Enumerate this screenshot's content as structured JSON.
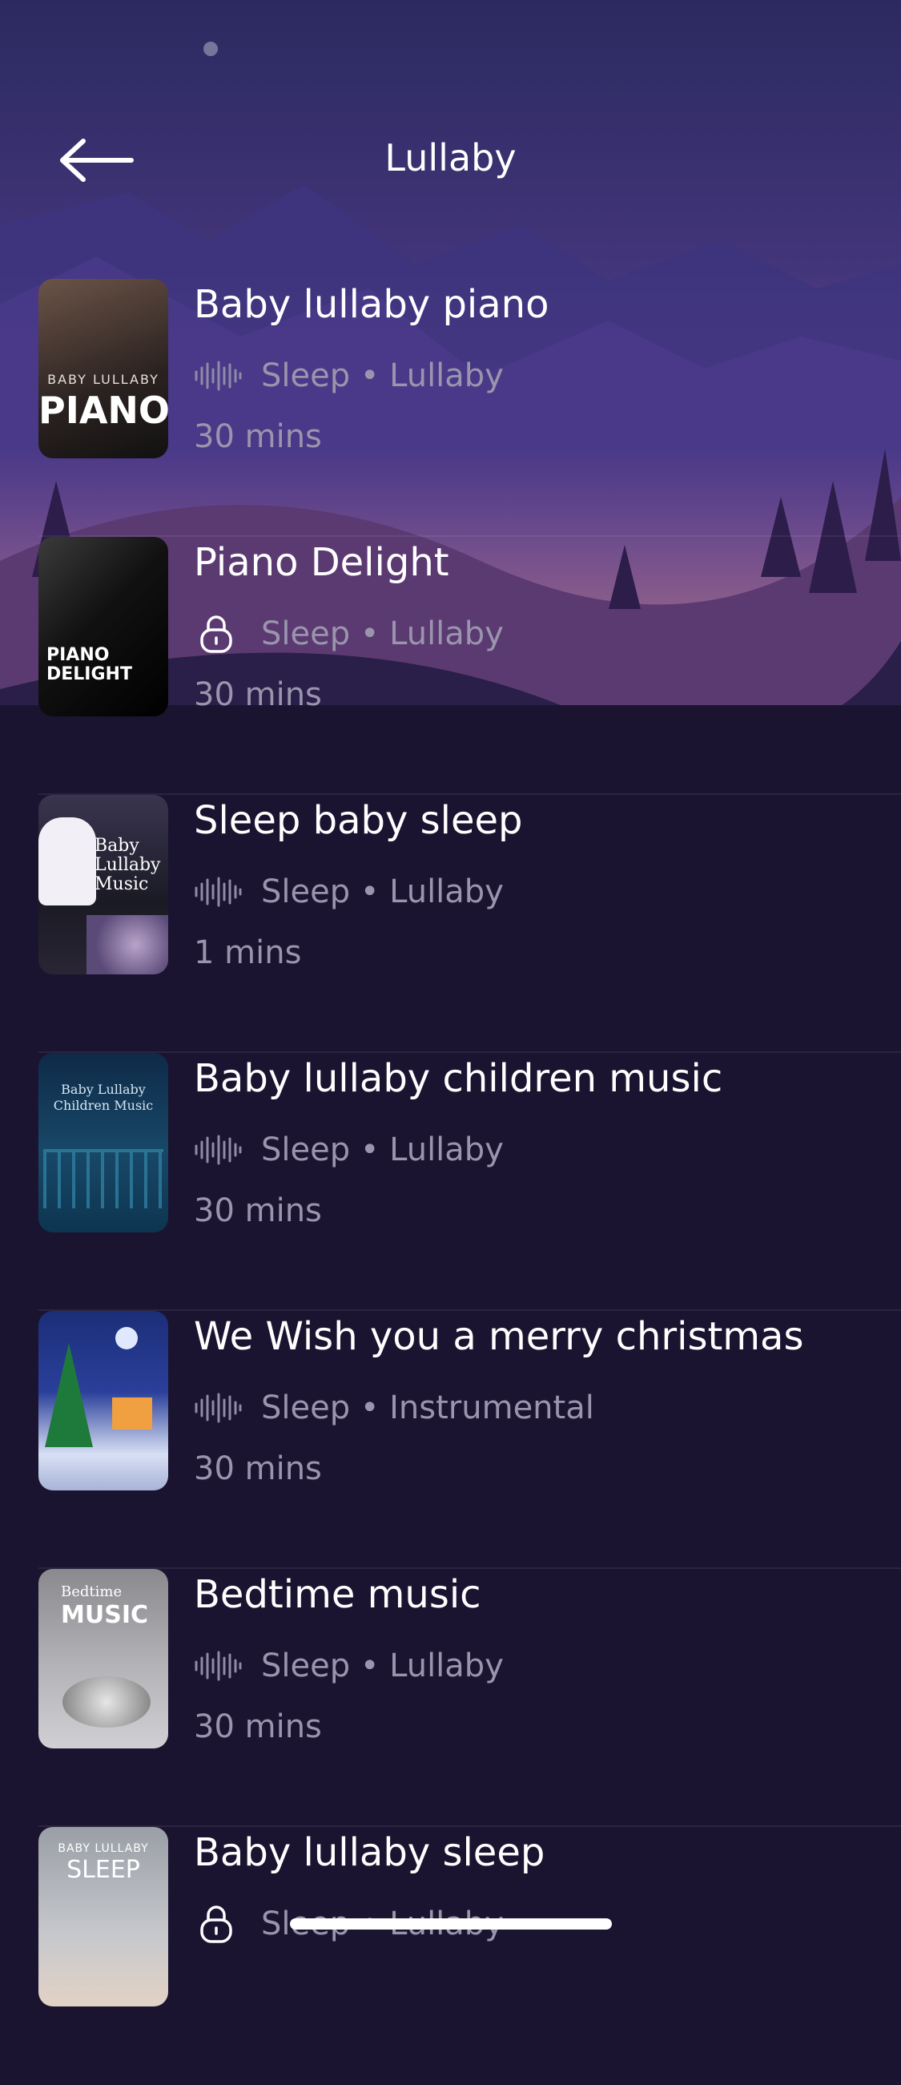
{
  "header": {
    "title": "Lullaby"
  },
  "icons": {
    "back": "arrow-left-icon",
    "audio": "waveform-icon",
    "locked": "lock-icon"
  },
  "tracks": [
    {
      "title": "Baby lullaby piano",
      "tags": "Sleep • Lullaby",
      "duration": "30 mins",
      "status_icon": "waveform-icon",
      "cover_text": [
        "BABY LULLABY",
        "PIANO"
      ]
    },
    {
      "title": "Piano Delight",
      "tags": "Sleep • Lullaby",
      "duration": "30 mins",
      "status_icon": "lock-icon",
      "cover_text": [
        "PIANO",
        "DELIGHT"
      ]
    },
    {
      "title": "Sleep baby sleep",
      "tags": "Sleep • Lullaby",
      "duration": "1 mins",
      "status_icon": "waveform-icon",
      "cover_text": [
        "Baby",
        "Lullaby",
        "Music"
      ]
    },
    {
      "title": "Baby lullaby children music",
      "tags": "Sleep • Lullaby",
      "duration": "30 mins",
      "status_icon": "waveform-icon",
      "cover_text": [
        "Baby Lullaby",
        "Children Music"
      ]
    },
    {
      "title": "We Wish you a merry christmas",
      "tags": "Sleep • Instrumental",
      "duration": "30 mins",
      "status_icon": "waveform-icon",
      "cover_text": []
    },
    {
      "title": "Bedtime music",
      "tags": "Sleep • Lullaby",
      "duration": "30 mins",
      "status_icon": "waveform-icon",
      "cover_text": [
        "Bedtime",
        "MUSIC"
      ]
    },
    {
      "title": "Baby lullaby sleep",
      "tags": "Sleep • Lullaby",
      "duration": "",
      "status_icon": "lock-icon",
      "cover_text": [
        "BABY LULLABY",
        "SLEEP"
      ]
    }
  ]
}
